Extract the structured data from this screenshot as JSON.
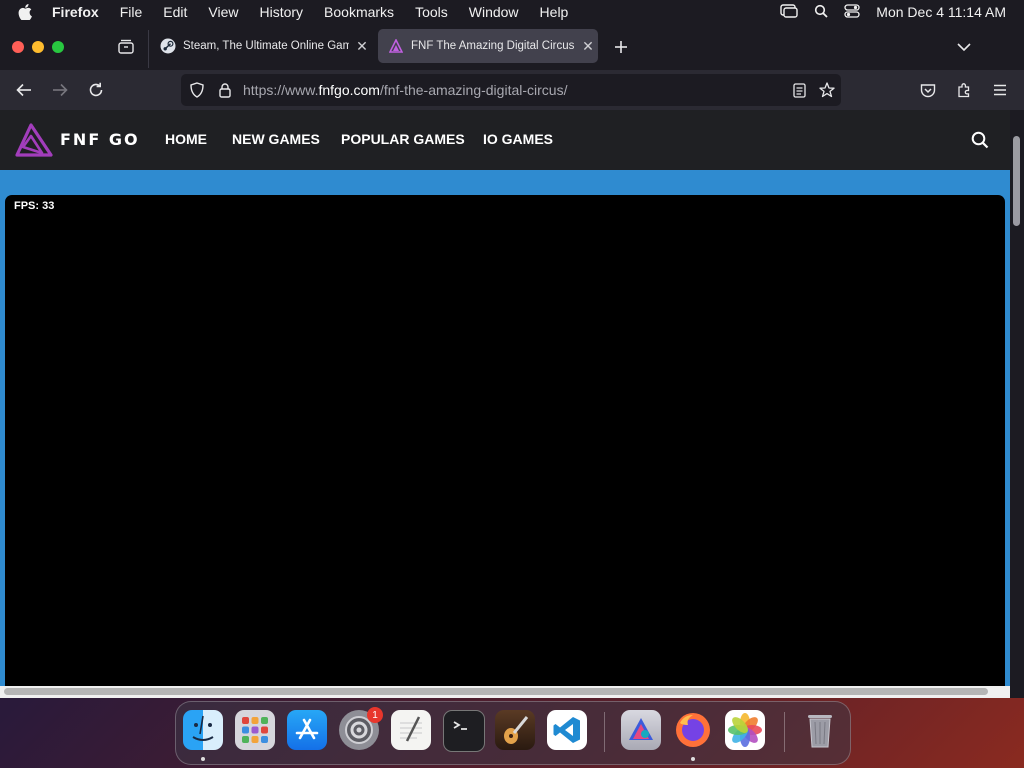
{
  "menubar": {
    "app_name": "Firefox",
    "items": [
      "File",
      "Edit",
      "View",
      "History",
      "Bookmarks",
      "Tools",
      "Window",
      "Help"
    ],
    "clock": "Mon Dec 4  11:14 AM"
  },
  "tabs": [
    {
      "title": "Steam, The Ultimate Online Game Platform",
      "favicon": "steam-icon",
      "active": false
    },
    {
      "title": "FNF The Amazing Digital Circus",
      "favicon": "fnfgo-icon",
      "active": true
    }
  ],
  "url": {
    "prefix": "https://www.",
    "domain": "fnfgo.com",
    "path": "/fnf-the-amazing-digital-circus/"
  },
  "site": {
    "brand": "FNF GO",
    "nav": [
      "HOME",
      "NEW GAMES",
      "POPULAR GAMES",
      "IO GAMES"
    ]
  },
  "game": {
    "fps_label": "FPS: 33"
  },
  "dock": {
    "apps": [
      "Finder",
      "Launchpad",
      "App Store",
      "System Settings",
      "TextEdit",
      "Terminal",
      "GarageBand",
      "Visual Studio Code",
      "Affinity",
      "Firefox",
      "Photos",
      "Trash"
    ],
    "settings_badge": "1"
  },
  "colors": {
    "accent": "#a23dbb",
    "page_bg": "#2f8bd0",
    "header_bg": "#1f2023",
    "chrome": "#2b2a33"
  }
}
